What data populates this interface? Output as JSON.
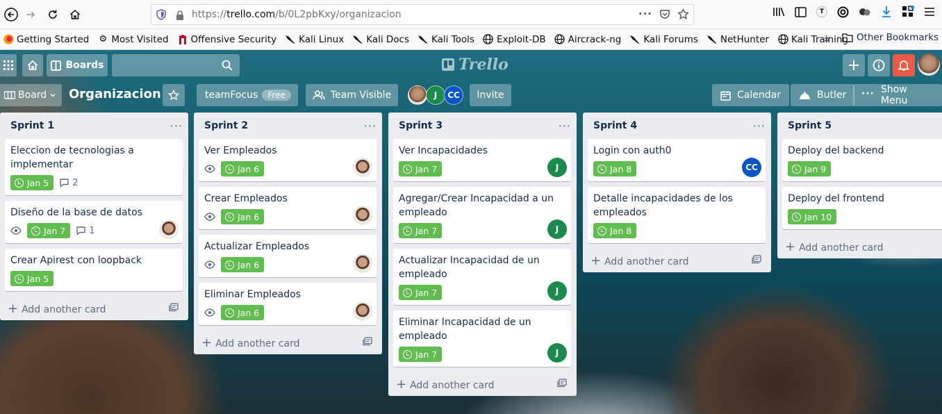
{
  "browser": {
    "url_prefix": "https://",
    "url_domain": "trello.com",
    "url_path": "/b/0L2pbKxy/organizacion"
  },
  "bookmarks": {
    "items": [
      "Getting Started",
      "Most Visited",
      "Offensive Security",
      "Kali Linux",
      "Kali Docs",
      "Kali Tools",
      "Exploit-DB",
      "Aircrack-ng",
      "Kali Forums",
      "NetHunter",
      "Kali Training"
    ],
    "other": "Other Bookmarks"
  },
  "header": {
    "boards_label": "Boards",
    "logo_text": "Trello"
  },
  "board": {
    "menu_label": "Board",
    "title": "Organizacion",
    "team_name": "teamFocus",
    "team_plan": "Free",
    "visibility": "Team Visible",
    "member_j": "J",
    "member_cc": "CC",
    "invite_label": "Invite",
    "calendar_label": "Calendar",
    "butler_label": "Butler",
    "show_menu_label": "Show Menu"
  },
  "add_card_label": "Add another card",
  "lists": [
    {
      "title": "Sprint 1",
      "cards": [
        {
          "title": "Eleccion de tecnologias a implementar",
          "due": "Jan 5",
          "comments": "2"
        },
        {
          "title": "Diseño de la base de datos",
          "due": "Jan 7",
          "comments": "1",
          "watch": true,
          "member": "photo"
        },
        {
          "title": "Crear Apirest con loopback",
          "due": "Jan 5"
        }
      ]
    },
    {
      "title": "Sprint 2",
      "cards": [
        {
          "title": "Ver Empleados",
          "due": "Jan 6",
          "watch": true,
          "member": "photo"
        },
        {
          "title": "Crear Empleados",
          "due": "Jan 6",
          "watch": true,
          "member": "photo"
        },
        {
          "title": "Actualizar Empleados",
          "due": "Jan 6",
          "watch": true,
          "member": "photo"
        },
        {
          "title": "Eliminar Empleados",
          "due": "Jan 6",
          "watch": true,
          "member": "photo"
        }
      ]
    },
    {
      "title": "Sprint 3",
      "cards": [
        {
          "title": "Ver Incapacidades",
          "due": "Jan 7",
          "member": "J"
        },
        {
          "title": "Agregar/Crear Incapacidad a un empleado",
          "due": "Jan 7",
          "member": "J"
        },
        {
          "title": "Actualizar Incapacidad de un empleado",
          "due": "Jan 7",
          "member": "J"
        },
        {
          "title": "Eliminar Incapacidad de un empleado",
          "due": "Jan 7",
          "member": "J"
        }
      ]
    },
    {
      "title": "Sprint 4",
      "cards": [
        {
          "title": "Login con auth0",
          "due": "Jan 8",
          "member": "CC"
        },
        {
          "title": "Detalle incapacidades de los empleados",
          "due": "Jan 8"
        }
      ]
    },
    {
      "title": "Sprint 5",
      "cards": [
        {
          "title": "Deploy del backend",
          "due": "Jan 9"
        },
        {
          "title": "Deploy del frontend",
          "due": "Jan 10"
        }
      ]
    }
  ],
  "colors": {
    "due_green": "#61bd4f",
    "member_j": "#1a8a4d",
    "member_cc": "#0a56c9",
    "notification": "#eb5a46"
  }
}
